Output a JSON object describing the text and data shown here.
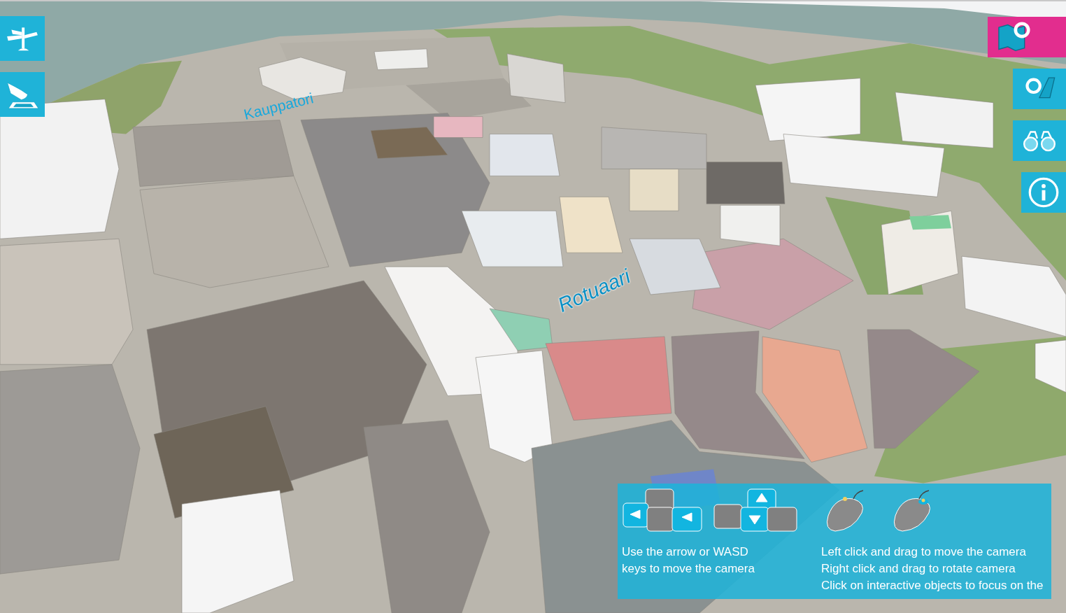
{
  "map": {
    "labels": [
      {
        "text": "Kauppatori",
        "kind": "small"
      },
      {
        "text": "Rotuaari",
        "kind": "large"
      }
    ]
  },
  "left_toolbar": [
    {
      "kind": "signpost",
      "selected": false
    },
    {
      "kind": "ballot",
      "selected": false
    }
  ],
  "right_toolbar": [
    {
      "kind": "map-search",
      "selected": true
    },
    {
      "kind": "search",
      "selected": false
    },
    {
      "kind": "binoculars",
      "selected": false
    },
    {
      "kind": "info",
      "selected": false
    }
  ],
  "help_panel": {
    "keyboard_text": [
      "Use the arrow or WASD",
      "keys to move the camera"
    ],
    "mouse_text": [
      "Left click and drag to move the camera",
      "Right click and drag to rotate camera",
      "Click on interactive objects to focus on the"
    ]
  }
}
